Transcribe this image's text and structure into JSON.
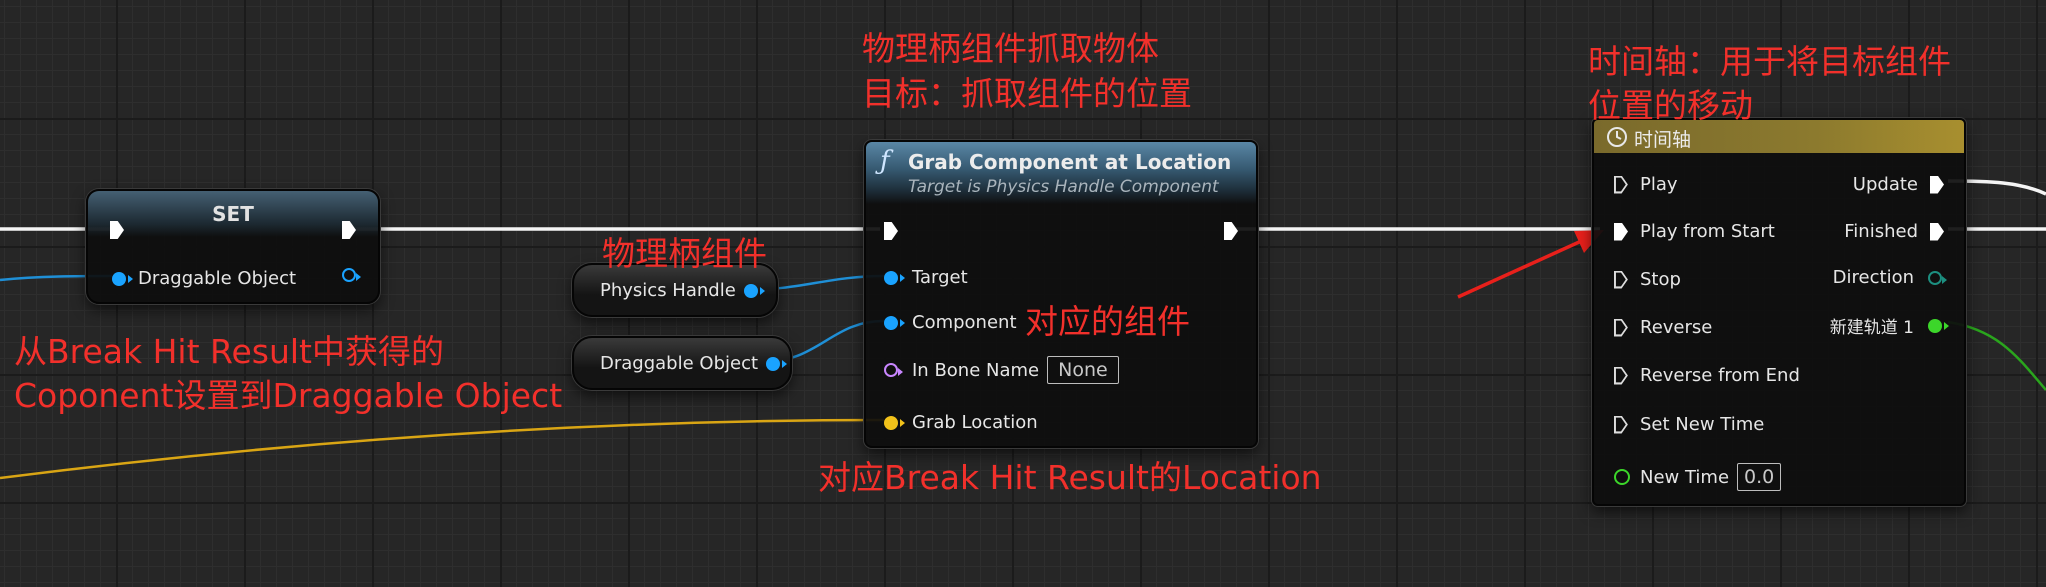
{
  "set_node": {
    "title": "SET",
    "draggable_object_label": "Draggable Object"
  },
  "physics_handle_node": {
    "label": "Physics Handle"
  },
  "draggable_object_node": {
    "label": "Draggable Object"
  },
  "grab_node": {
    "function_icon": "ƒ",
    "title": "Grab Component at Location",
    "subtitle": "Target is Physics Handle Component",
    "pins": {
      "target": "Target",
      "component": "Component",
      "in_bone_name": "In Bone Name",
      "in_bone_name_value": "None",
      "grab_location": "Grab Location"
    }
  },
  "timeline_node": {
    "title": "时间轴",
    "inputs": {
      "play": "Play",
      "play_from_start": "Play from Start",
      "stop": "Stop",
      "reverse": "Reverse",
      "reverse_from_end": "Reverse from End",
      "set_new_time": "Set New Time",
      "new_time": "New Time",
      "new_time_value": "0.0"
    },
    "outputs": {
      "update": "Update",
      "finished": "Finished",
      "direction": "Direction",
      "new_track": "新建轨道 1"
    }
  },
  "annotations": {
    "grab_title_line1": "物理柄组件抓取物体",
    "grab_title_line2": "目标：抓取组件的位置",
    "timeline_line1": "时间轴：用于将目标组件",
    "timeline_line2": "位置的移动",
    "physics_handle": "物理柄组件",
    "component": "对应的组件",
    "break_line1": "从Break Hit Result中获得的",
    "break_line2": "Coponent设置到Draggable Object",
    "location": "对应Break Hit Result的Location"
  },
  "colors": {
    "exec_wire": "#ffffff",
    "object_pin": "#1aa3ff",
    "vector_pin": "#f2c21a",
    "name_pin": "#c986ff",
    "float_pin": "#3cd62a",
    "annotation": "#f2302b"
  }
}
